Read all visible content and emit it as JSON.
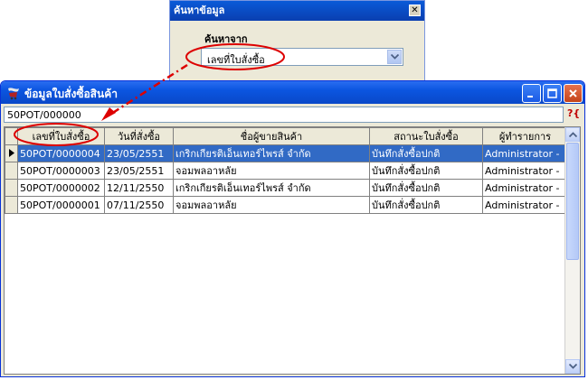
{
  "search_dialog": {
    "title": "ค้นหาข้อมูล",
    "search_from_label": "ค้นหาจาก",
    "search_field_value": "เลขที่ใบสั่งซื้อ"
  },
  "window": {
    "title": "ข้อมูลใบสั่งซื้อสินค้า",
    "filter_value": "50POT/000000",
    "filter_icon": "?{"
  },
  "table": {
    "columns": [
      "เลขที่ใบสั่งซื้อ",
      "วันที่สั่งซื้อ",
      "ชื่อผู้ขายสินค้า",
      "สถานะใบสั่งซื้อ",
      "ผู้ทำรายการ"
    ],
    "rows": [
      [
        "50POT/0000004",
        "23/05/2551",
        "เกริกเกียรติเอ็นเทอร์ไพรส์ จำกัด",
        "บันทึกสั่งซื้อปกติ",
        "Administrator -"
      ],
      [
        "50POT/0000003",
        "23/05/2551",
        "จอมพลอาหลัย",
        "บันทึกสั่งซื้อปกติ",
        "Administrator -"
      ],
      [
        "50POT/0000002",
        "12/11/2550",
        "เกริกเกียรติเอ็นเทอร์ไพรส์ จำกัด",
        "บันทึกสั่งซื้อปกติ",
        "Administrator -"
      ],
      [
        "50POT/0000001",
        "07/11/2550",
        "จอมพลอาหลัย",
        "บันทึกสั่งซื้อปกติ",
        "Administrator -"
      ]
    ],
    "selected_row": 0
  },
  "icons": {
    "dialog_close": "close-icon",
    "window_app": "app-icon",
    "minimize": "minimize-icon",
    "maximize": "maximize-icon",
    "close": "close-icon",
    "row_pointer": "row-pointer-icon",
    "dropdown": "chevron-down-icon"
  },
  "colors": {
    "title_bar": "#0a55e0",
    "selection": "#316ac5",
    "annotation": "#dd0000"
  }
}
